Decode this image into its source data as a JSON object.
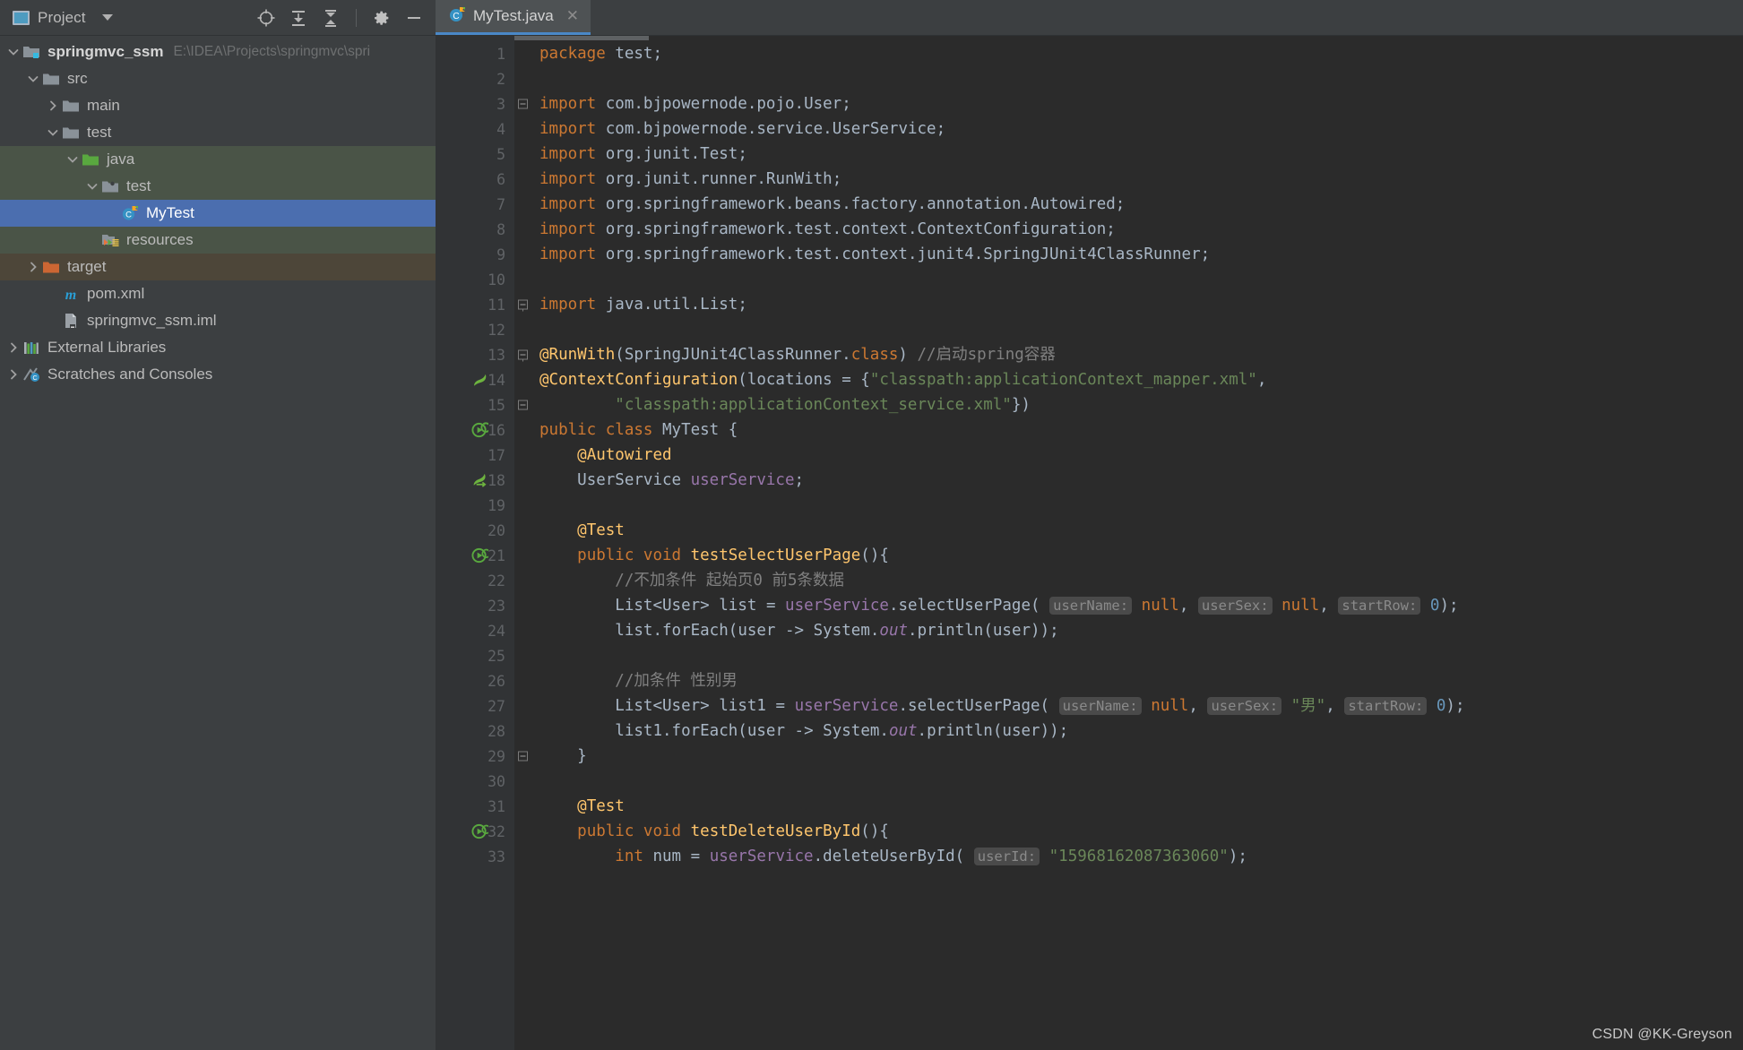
{
  "window": {
    "tool_window": {
      "title": "Project",
      "title_icon": "project-window-icon",
      "dropdown_icon": "chevron-down-icon",
      "actions": [
        {
          "name": "locate-icon",
          "glyph": "target"
        },
        {
          "name": "expand-all-icon",
          "glyph": "expand-all"
        },
        {
          "name": "collapse-all-icon",
          "glyph": "collapse-all"
        },
        {
          "name": "settings-gear-icon",
          "glyph": "gear"
        },
        {
          "name": "hide-window-icon",
          "glyph": "minus"
        }
      ]
    }
  },
  "project_tree": {
    "nodes": [
      {
        "label": "springmvc_ssm",
        "sub": "E:\\IDEA\\Projects\\springmvc\\spri",
        "indent": 0,
        "arrow": "down",
        "icon": "module-icon",
        "bold": true,
        "state": "normal"
      },
      {
        "label": "src",
        "sub": "",
        "indent": 1,
        "arrow": "down",
        "icon": "folder-icon",
        "bold": false,
        "state": "normal"
      },
      {
        "label": "main",
        "sub": "",
        "indent": 2,
        "arrow": "right",
        "icon": "folder-icon",
        "bold": false,
        "state": "normal"
      },
      {
        "label": "test",
        "sub": "",
        "indent": 2,
        "arrow": "down",
        "icon": "folder-icon",
        "bold": false,
        "state": "normal"
      },
      {
        "label": "java",
        "sub": "",
        "indent": 3,
        "arrow": "down",
        "icon": "test-source-folder-icon",
        "bold": false,
        "state": "test"
      },
      {
        "label": "test",
        "sub": "",
        "indent": 4,
        "arrow": "down",
        "icon": "package-icon",
        "bold": false,
        "state": "test"
      },
      {
        "label": "MyTest",
        "sub": "",
        "indent": 5,
        "arrow": "none",
        "icon": "java-class-icon",
        "bold": false,
        "state": "selected"
      },
      {
        "label": "resources",
        "sub": "",
        "indent": 4,
        "arrow": "none",
        "icon": "test-resources-folder-icon",
        "bold": false,
        "state": "test"
      },
      {
        "label": "target",
        "sub": "",
        "indent": 1,
        "arrow": "right",
        "icon": "excluded-folder-icon",
        "bold": false,
        "state": "target"
      },
      {
        "label": "pom.xml",
        "sub": "",
        "indent": 2,
        "arrow": "none",
        "icon": "maven-icon",
        "bold": false,
        "state": "normal"
      },
      {
        "label": "springmvc_ssm.iml",
        "sub": "",
        "indent": 2,
        "arrow": "none",
        "icon": "iml-file-icon",
        "bold": false,
        "state": "normal"
      },
      {
        "label": "External Libraries",
        "sub": "",
        "indent": 0,
        "arrow": "right",
        "icon": "libraries-icon",
        "bold": false,
        "state": "normal"
      },
      {
        "label": "Scratches and Consoles",
        "sub": "",
        "indent": 0,
        "arrow": "right",
        "icon": "scratches-icon",
        "bold": false,
        "state": "normal"
      }
    ]
  },
  "editor": {
    "tab": {
      "label": "MyTest.java",
      "icon": "java-class-icon",
      "close_icon": "close-icon"
    },
    "first_line_number": 1,
    "line_numbers": [
      1,
      2,
      3,
      4,
      5,
      6,
      7,
      8,
      9,
      10,
      11,
      12,
      13,
      14,
      15,
      16,
      17,
      18,
      19,
      20,
      21,
      22,
      23,
      24,
      25,
      26,
      27,
      28,
      29,
      30,
      31,
      32,
      33
    ],
    "gutter_icons": [
      {
        "line": 14,
        "name": "spring-bean-icon"
      },
      {
        "line": 16,
        "name": "run-test-class-icon"
      },
      {
        "line": 18,
        "name": "spring-autowired-icon"
      },
      {
        "line": 21,
        "name": "run-test-method-icon"
      },
      {
        "line": 32,
        "name": "run-test-method-icon"
      }
    ],
    "fold_markers": [
      {
        "line": 3,
        "type": "collapse-imports"
      },
      {
        "line": 11,
        "type": "fold-start"
      },
      {
        "line": 13,
        "type": "fold-start"
      },
      {
        "line": 15,
        "type": "fold-end"
      },
      {
        "line": 29,
        "type": "fold-end"
      }
    ],
    "code_lines": [
      "package test;",
      "",
      "import com.bjpowernode.pojo.User;",
      "import com.bjpowernode.service.UserService;",
      "import org.junit.Test;",
      "import org.junit.runner.RunWith;",
      "import org.springframework.beans.factory.annotation.Autowired;",
      "import org.springframework.test.context.ContextConfiguration;",
      "import org.springframework.test.context.junit4.SpringJUnit4ClassRunner;",
      "",
      "import java.util.List;",
      "",
      "@RunWith(SpringJUnit4ClassRunner.class) //启动spring容器",
      "@ContextConfiguration(locations = {\"classpath:applicationContext_mapper.xml\",",
      "        \"classpath:applicationContext_service.xml\"})",
      "public class MyTest {",
      "    @Autowired",
      "    UserService userService;",
      "",
      "    @Test",
      "    public void testSelectUserPage(){",
      "        //不加条件 起始页0 前5条数据",
      "        List<User> list = userService.selectUserPage( userName: null, userSex: null, startRow: 0);",
      "        list.forEach(user -> System.out.println(user));",
      "",
      "        //加条件 性别男",
      "        List<User> list1 = userService.selectUserPage( userName: null, userSex: \"男\", startRow: 0);",
      "        list1.forEach(user -> System.out.println(user));",
      "    }",
      "",
      "    @Test",
      "    public void testDeleteUserById(){",
      "        int num = userService.deleteUserById( userId: \"15968162087363060\");"
    ],
    "parameter_hints": [
      "userName:",
      "userSex:",
      "startRow:",
      "userId:"
    ]
  },
  "watermark": {
    "text": "CSDN @KK-Greyson"
  },
  "colors": {
    "background": "#3c3f41",
    "editor_background": "#2b2b2b",
    "gutter_background": "#313335",
    "selection": "#4b6eaf",
    "test_scope": "#4a5447",
    "target_scope": "#4d4639",
    "keyword": "#cc7832",
    "string": "#6a8759",
    "class_name": "#ffc66d",
    "field": "#9876aa",
    "comment": "#808080",
    "number": "#6897bb",
    "default_text": "#a9b7c6",
    "highlight": "#6f6b3f"
  }
}
